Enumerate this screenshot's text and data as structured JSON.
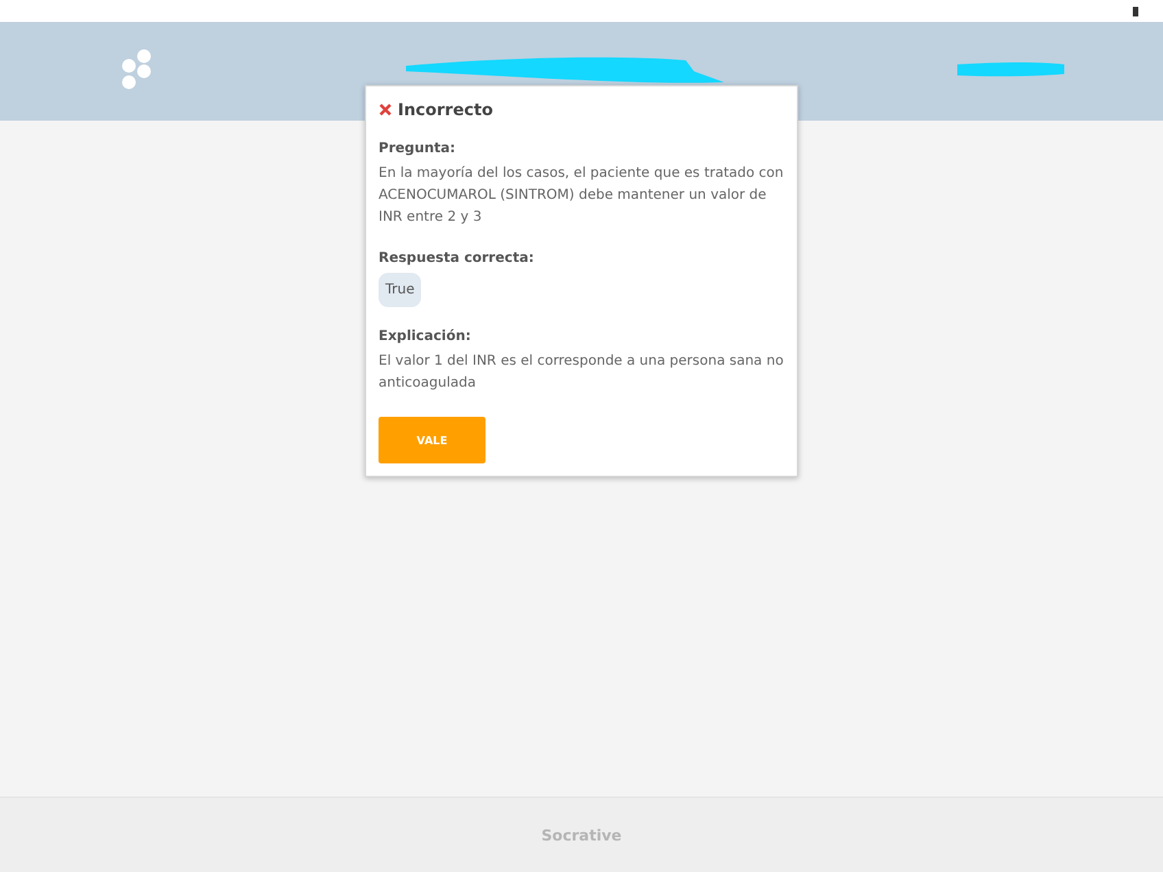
{
  "footer": {
    "brand": "Socrative"
  },
  "feedback": {
    "correct": false,
    "title": "Incorrecto",
    "sections": [
      {
        "kind": "text",
        "heading": "Pregunta:",
        "text": "En la mayoría del los casos, el paciente que es tratado con ACENOCUMAROL (SINTROM) debe mantener un valor de INR entre 2 y 3"
      },
      {
        "kind": "answer",
        "heading": "Respuesta correcta:",
        "text": "True"
      },
      {
        "kind": "text",
        "heading": "Explicación:",
        "text": "El valor 1 del INR es el corresponde a una persona sana no anticoagulada"
      }
    ],
    "button": "VALE"
  }
}
